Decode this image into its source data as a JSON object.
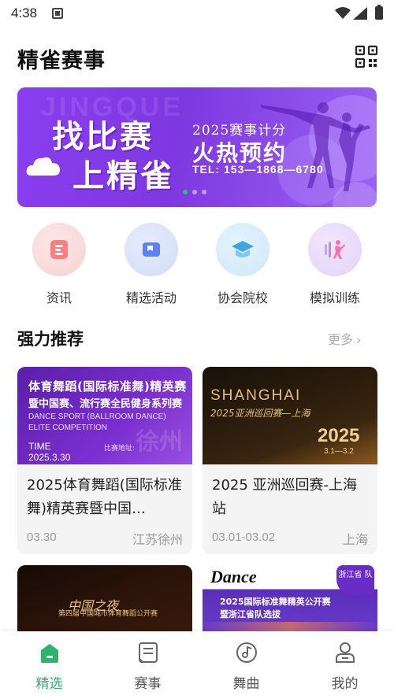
{
  "status_bar": {
    "time": "4:38"
  },
  "header": {
    "title": "精雀赛事"
  },
  "banner": {
    "watermark": "JINGQUE",
    "slogan_line1": "找比赛",
    "slogan_line2": "上精雀",
    "subtitle": "2025赛事计分",
    "headline": "火热预约",
    "tel": "TEL: 153—1868—6780"
  },
  "quick_menu": [
    {
      "label": "资讯",
      "icon": "news-icon",
      "color": "#f08a8a"
    },
    {
      "label": "精选活动",
      "icon": "activity-icon",
      "color": "#6a8cf0"
    },
    {
      "label": "协会院校",
      "icon": "school-icon",
      "color": "#5ab0e8"
    },
    {
      "label": "模拟训练",
      "icon": "training-icon",
      "color": "#b07ae8"
    }
  ],
  "section": {
    "title": "强力推荐",
    "more_label": "更多"
  },
  "cards": [
    {
      "title": "2025体育舞蹈(国际标准舞)精英赛暨中国…",
      "date": "03.30",
      "city": "江苏徐州",
      "poster_line1": "体育舞蹈(国际标准舞)精英赛",
      "poster_line2": "暨中国赛、流行赛全民健身系列赛",
      "poster_en1": "DANCE SPORT (BALLROOM DANCE)",
      "poster_en2": "ELITE COMPETITION",
      "poster_time_label": "TIME",
      "poster_time": "2025.3.30",
      "poster_venue": "比赛地址:",
      "poster_watermark": "徐州"
    },
    {
      "title": "2025 亚洲巡回赛-上海站",
      "date": "03.01-03.02",
      "city": "上海",
      "poster_line1": "SHANGHAI",
      "poster_line2": "2025亚洲巡回赛—上海",
      "poster_year": "2025",
      "poster_dates": "3.1—3.2"
    },
    {
      "poster_line1": "中国之夜",
      "poster_line2": "第四届中国城市体育舞蹈公开赛"
    },
    {
      "poster_brand": "Dance",
      "poster_badge": "浙江省 队",
      "poster_line1": "2025国际标准舞精英公开赛",
      "poster_line2": "暨浙江省队选拔"
    }
  ],
  "tabs": [
    {
      "label": "精选",
      "icon": "home-icon",
      "active": true
    },
    {
      "label": "赛事",
      "icon": "events-icon",
      "active": false
    },
    {
      "label": "舞曲",
      "icon": "music-icon",
      "active": false
    },
    {
      "label": "我的",
      "icon": "profile-icon",
      "active": false
    }
  ],
  "colors": {
    "accent": "#2fb36e",
    "banner": "#8a3ef0",
    "muted": "#9a9a9a"
  }
}
